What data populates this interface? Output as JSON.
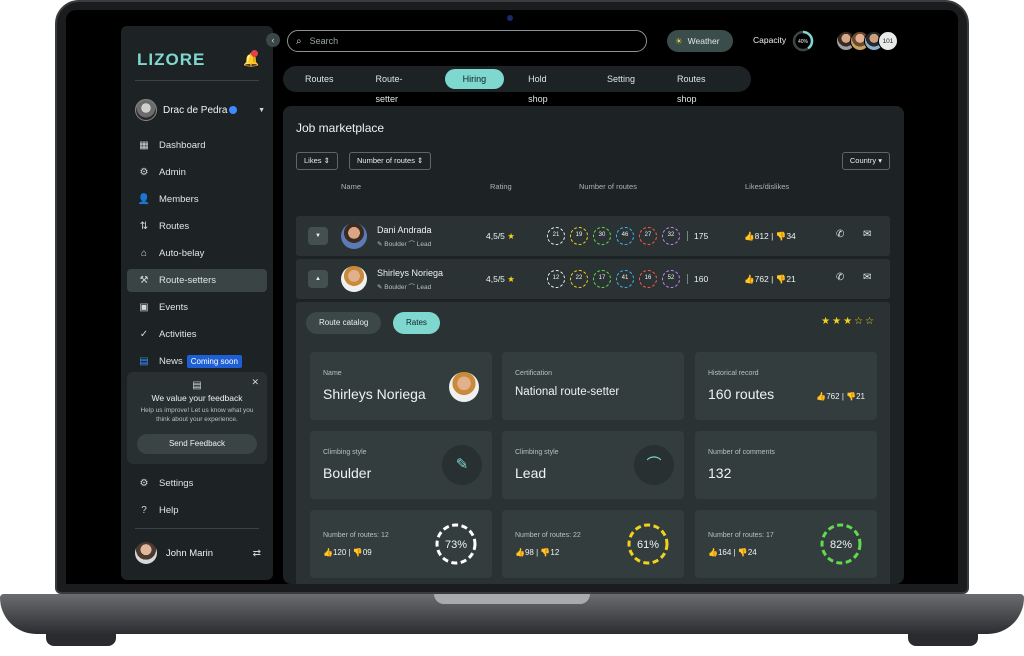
{
  "app": {
    "logo": "LIZORE",
    "sidebar_toggle": "‹"
  },
  "user_top": {
    "name": "Drac de Pedra"
  },
  "sidebar": {
    "items": [
      {
        "label": "Dashboard",
        "icon": "▦"
      },
      {
        "label": "Admin",
        "icon": "⚙"
      },
      {
        "label": "Members",
        "icon": "👤"
      },
      {
        "label": "Routes",
        "icon": "⇅"
      },
      {
        "label": "Auto-belay",
        "icon": "⌂"
      },
      {
        "label": "Route-setters",
        "icon": "⚒"
      },
      {
        "label": "Events",
        "icon": "▣"
      },
      {
        "label": "Activities",
        "icon": "✓"
      },
      {
        "label": "News",
        "icon": "▤"
      }
    ],
    "news_badge": "Coming soon",
    "bottom_items": [
      {
        "label": "Settings",
        "icon": "⚙"
      },
      {
        "label": "Help",
        "icon": "?"
      }
    ]
  },
  "feedback": {
    "title": "We value your feedback",
    "text": "Help us improve! Let us know what you think about your experience.",
    "button": "Send Feedback"
  },
  "user_bottom": {
    "name": "John Marin"
  },
  "topbar": {
    "search_placeholder": "Search",
    "weather": "Weather",
    "capacity_label": "Capacity",
    "capacity_value": "40%",
    "capacity_fraction": 0.4,
    "extra_users": "101"
  },
  "tabs": [
    "Routes",
    "Route-setter",
    "Hiring",
    "Hold shop",
    "Setting",
    "Routes shop"
  ],
  "main": {
    "title": "Job marketplace",
    "filters": [
      "Likes",
      "Number of routes"
    ],
    "country": "Country",
    "headers": {
      "name": "Name",
      "rating": "Rating",
      "routes": "Number of routes",
      "likes": "Likes/dislikes"
    },
    "rows": [
      {
        "name": "Dani Andrada",
        "style1": "Boulder",
        "style2": "Lead",
        "rating": "4,5/5",
        "grades": [
          "21",
          "19",
          "30",
          "46",
          "27",
          "32"
        ],
        "total": "175",
        "likes": "812",
        "dislikes": "34"
      },
      {
        "name": "Shirleys Noriega",
        "style1": "Boulder",
        "style2": "Lead",
        "rating": "4,5/5",
        "grades": [
          "12",
          "22",
          "17",
          "41",
          "16",
          "52"
        ],
        "total": "160",
        "likes": "762",
        "dislikes": "21"
      }
    ],
    "grade_colors": [
      "#e8eeee",
      "#f2d31b",
      "#5fdc4b",
      "#3ab6ff",
      "#ff5a4a",
      "#c780ff"
    ]
  },
  "detail": {
    "buttons": [
      "Route catalog",
      "Rates"
    ],
    "stars_filled": 3,
    "stars_total": 5,
    "cards": {
      "name_label": "Name",
      "name_value": "Shirleys Noriega",
      "cert_label": "Certification",
      "cert_value": "National route-setter",
      "hist_label": "Historical record",
      "hist_value": "160 routes",
      "hist_likes": "762",
      "hist_dislikes": "21",
      "style1_label": "Climbing style",
      "style1_value": "Boulder",
      "style2_label": "Climbing style",
      "style2_value": "Lead",
      "comments_label": "Number of comments",
      "comments_value": "132"
    },
    "stats": [
      {
        "label": "Number of routes: 12",
        "likes": "120",
        "dislikes": "09",
        "pct_label": "73%",
        "pct": 0.73,
        "color": "#ffffff"
      },
      {
        "label": "Number of routes: 22",
        "likes": "98",
        "dislikes": "12",
        "pct_label": "61%",
        "pct": 0.61,
        "color": "#f2d31b"
      },
      {
        "label": "Number of routes: 17",
        "likes": "164",
        "dislikes": "24",
        "pct_label": "82%",
        "pct": 0.82,
        "color": "#5fdc4b"
      }
    ]
  }
}
